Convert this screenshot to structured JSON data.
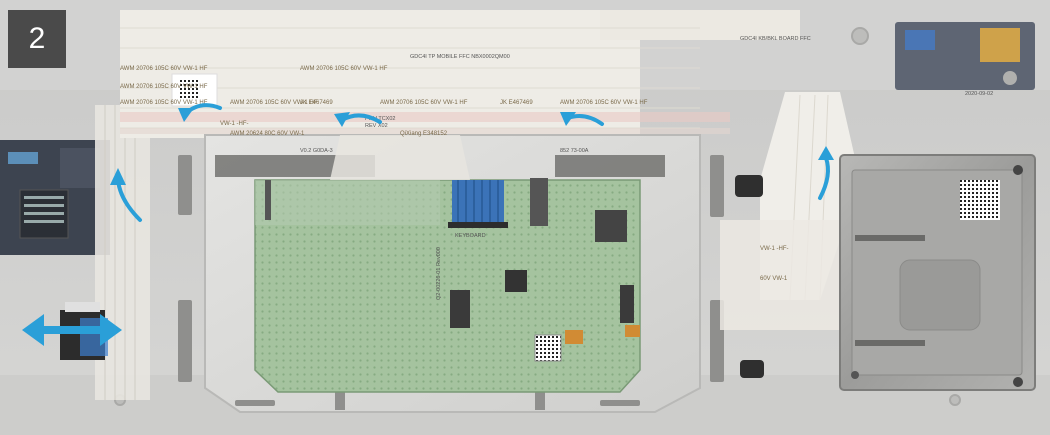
{
  "step": {
    "number": "2"
  },
  "cable_print": {
    "ffc_line": "AWM 20706 105C 60V VW-1 HF",
    "jk_code": "JK E467469",
    "qixiang": "QiXiang E348152",
    "vw_line": "VW-1 -HF-",
    "awm_short": "AWM 20624 80C 60V VW-1",
    "vw_short": "60V VW-1"
  },
  "board_labels": {
    "touchpad_top": "V0.2 G0DA-3",
    "touchpad_right": "852 73-00A",
    "keyboard": "KEYBOARD",
    "pn_line1": "PIN:LTCX02",
    "pn_line2": "REV X02",
    "ffc_label": "GDC4I TP MOBILE FFC NBX0002QM00",
    "kb_label": "GDC4I KB/BKL BOARD FFC",
    "board_code": "Q2-00226-01 Rev000",
    "date": "2020-09-02"
  },
  "colors": {
    "arrow": "#2a9fd8",
    "board": "#9fbe9a",
    "tape": "#cfd7e0"
  }
}
